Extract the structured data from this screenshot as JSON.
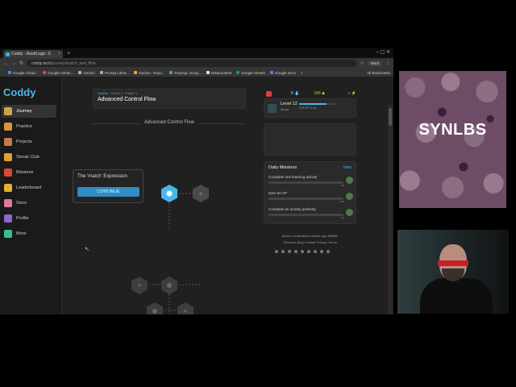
{
  "browser": {
    "tab_title": "Coddy - Rust/Logic: S",
    "tab_close": "×",
    "new_tab": "+",
    "window_controls": "–  ▢  ✕",
    "url_host": "coddy.tech",
    "url_path": "/journey/match_and_flow",
    "profile": "Work",
    "bookmarks": [
      "Google Cloud...",
      "Google Admin...",
      "Gemini",
      "Prompt Librar...",
      "Nucleo - Expo...",
      "SerpApi: Goog...",
      "NotebookLM",
      "Google Sheets",
      "Google Docs"
    ],
    "bookmarks_more": "»",
    "all_bookmarks": "All Bookmarks"
  },
  "sidebar": {
    "logo": "Coddy",
    "items": [
      {
        "label": "Journey",
        "icon": "journey-icon",
        "color": "#c9a54a"
      },
      {
        "label": "Practice",
        "icon": "practice-icon",
        "color": "#d9933a"
      },
      {
        "label": "Projects",
        "icon": "projects-icon",
        "color": "#c97a4a"
      },
      {
        "label": "Streak Club",
        "icon": "streak-icon",
        "color": "#e0a030"
      },
      {
        "label": "Missions",
        "icon": "missions-icon",
        "color": "#d94a3a"
      },
      {
        "label": "Leaderboard",
        "icon": "trophy-icon",
        "color": "#e0b030"
      },
      {
        "label": "Store",
        "icon": "store-icon",
        "color": "#d97aa0"
      },
      {
        "label": "Profile",
        "icon": "profile-icon",
        "color": "#8a6ad0"
      },
      {
        "label": "More",
        "icon": "more-icon",
        "color": "#3ac08a"
      }
    ]
  },
  "header": {
    "syllabus": "Syllabus",
    "crumb": " · Section 2 · Chapter 1",
    "title": "Advanced Control Flow"
  },
  "section_divider": "Advanced Control Flow",
  "popup": {
    "title": "The 'match' Expression",
    "button": "CONTINUE"
  },
  "stats": {
    "heart": "♥",
    "streak": "5",
    "streak_icon": "💧",
    "gems": "186",
    "gems_icon": "◆",
    "infinite": "∞ ⚡"
  },
  "level": {
    "label": "Level 12",
    "tier": "Mega",
    "xp_to_go": "24% XP to go",
    "progress_pct": 76
  },
  "missions": {
    "title": "Daily Missions",
    "view": "View",
    "items": [
      {
        "label": "Complete one learning activity",
        "value": "0/1"
      },
      {
        "label": "Earn 50 XP",
        "value": "0/50"
      },
      {
        "label": "Complete an activity perfectly",
        "value": "0/1"
      }
    ]
  },
  "footer": {
    "row1": "About  Certifications  Mobile App  Affiliate",
    "row2": "Teachers  Blog  Contact  Privacy  Terms"
  },
  "overlay": {
    "brand": "SYNLBS"
  }
}
